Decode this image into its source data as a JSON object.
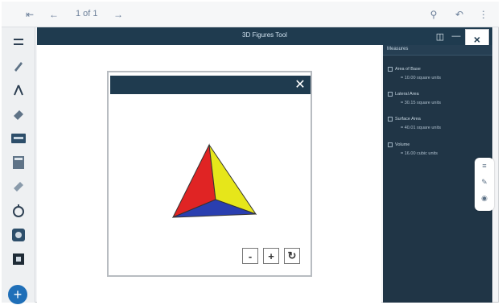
{
  "toolbar": {
    "page_indicator": "1 of 1"
  },
  "app": {
    "title": "3D Figures Tool"
  },
  "panel": {
    "title": "Measures",
    "items": [
      {
        "label": "Area of Base",
        "value": "= 10.00 square units"
      },
      {
        "label": "Lateral Area",
        "value": "= 30.15 square units"
      },
      {
        "label": "Surface Area",
        "value": "= 40.01 square units"
      },
      {
        "label": "Volume",
        "value": "= 16.00 cubic units"
      }
    ]
  },
  "dialog": {
    "zoom_out_label": "-",
    "zoom_in_label": "+"
  },
  "colors": {
    "header": "#1f3b4f",
    "panel": "#203546",
    "face_left": "#e02424",
    "face_right": "#e6e61a",
    "face_base": "#2a3fb0",
    "accent": "#1f6fb8"
  },
  "icons": {
    "rail": [
      "menu-icon",
      "pencil-icon",
      "compass-icon",
      "eraser-icon",
      "keyboard-icon",
      "calculator-icon",
      "ruler-icon",
      "stopwatch-icon",
      "capture-icon",
      "exit-icon"
    ]
  }
}
